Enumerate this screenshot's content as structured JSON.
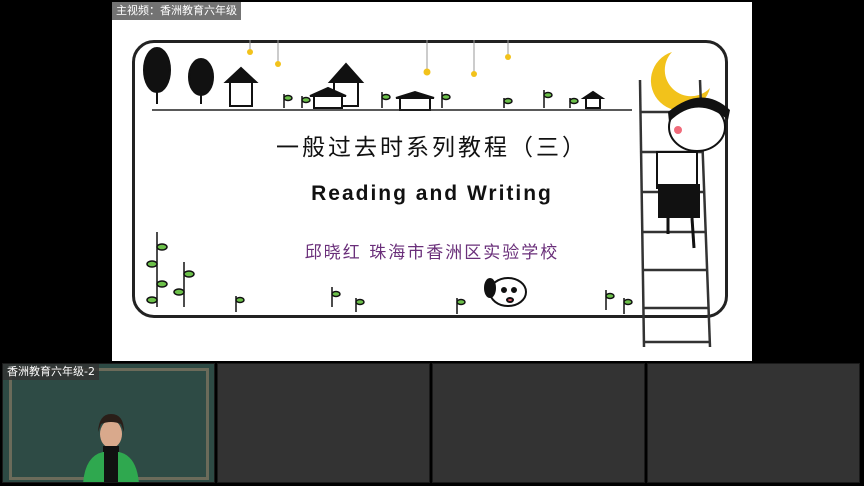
{
  "main": {
    "label": "主视频：香洲教育六年级",
    "slide": {
      "title": "一般过去时系列教程（三）",
      "subtitle": "Reading and Writing",
      "author": "邱晓红   珠海市香洲区实验学校"
    }
  },
  "thumbnails": [
    {
      "label": "香洲教育六年级-2",
      "has_video": true
    },
    {
      "label": "",
      "has_video": false
    },
    {
      "label": "",
      "has_video": false
    },
    {
      "label": "",
      "has_video": false
    }
  ],
  "colors": {
    "background": "#000000",
    "author_text": "#6a2f7a",
    "presenter_top": "#2fa84f",
    "chalkboard": "#2e4b45",
    "moon": "#f2c21b"
  }
}
